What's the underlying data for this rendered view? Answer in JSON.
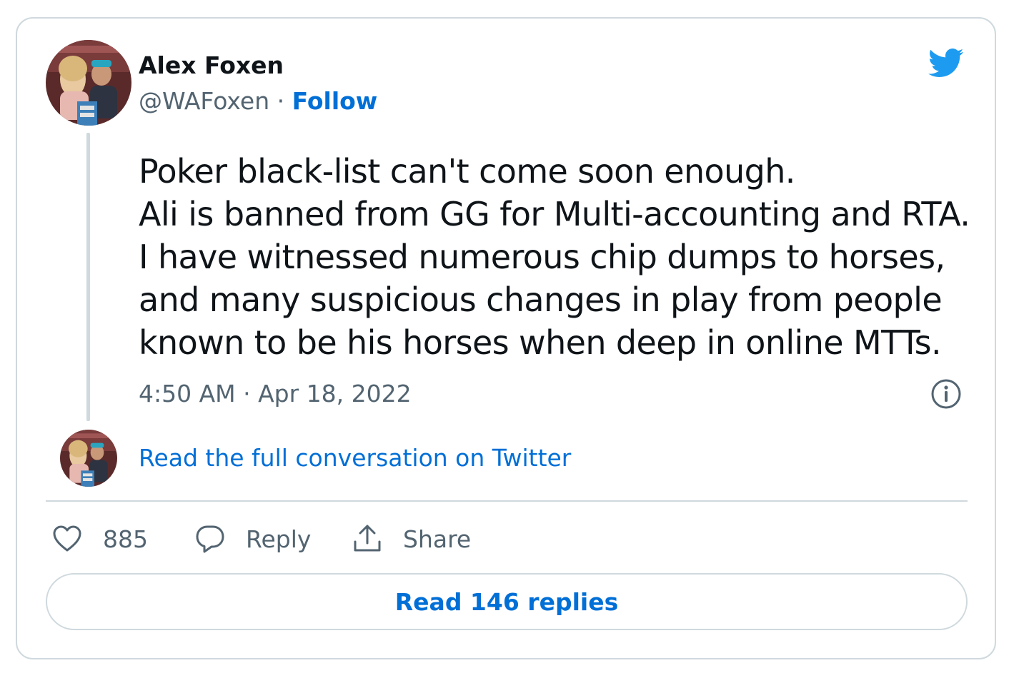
{
  "tweet": {
    "author_name": "Alex Foxen",
    "handle": "@WAFoxen",
    "separator": "·",
    "follow_label": "Follow",
    "text_lines": [
      "Poker black-list can't come soon enough.",
      "Ali is banned from GG for Multi-accounting and RTA.",
      "I have witnessed numerous chip dumps to horses,",
      "and many suspicious changes in play from people",
      "known to be his horses when deep in online MTTs."
    ],
    "timestamp": "4:50 AM · Apr 18, 2022",
    "conversation_link": "Read the full conversation on Twitter"
  },
  "actions": {
    "like_count": "885",
    "reply_label": "Reply",
    "share_label": "Share",
    "read_replies_label": "Read 146 replies"
  },
  "icons": {
    "brand": "twitter-bird-icon",
    "info": "info-icon",
    "like": "heart-icon",
    "reply": "speech-bubble-icon",
    "share": "share-upload-icon"
  },
  "colors": {
    "twitter_blue": "#1d9bf0",
    "link_blue": "#006fd6",
    "secondary_text": "#536471",
    "border": "#cfd9de"
  }
}
